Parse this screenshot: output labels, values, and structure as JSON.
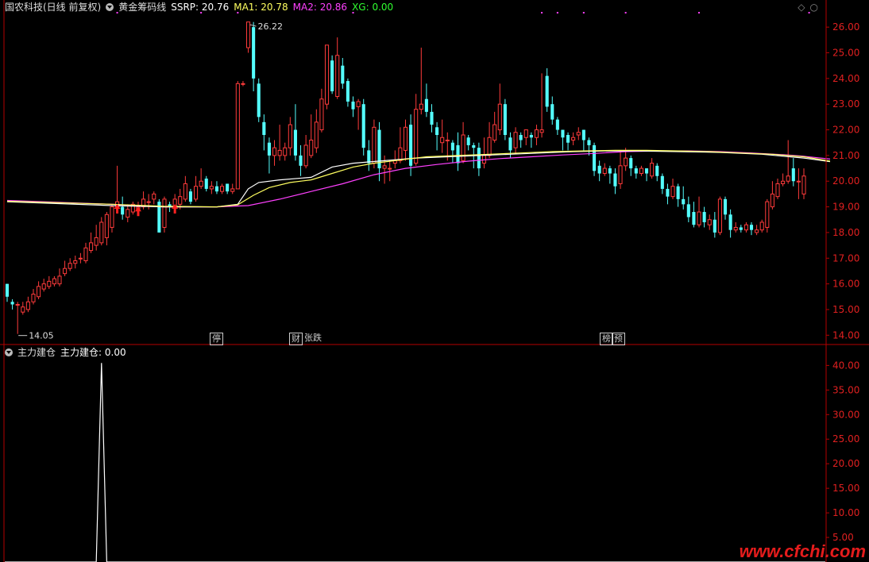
{
  "header": {
    "stock_title": "国农科技(日线 前复权)",
    "indicator_name": "黄金筹码线",
    "ssrp": "SSRP: 20.76",
    "ma1": "MA1: 20.78",
    "ma2": "MA2: 20.86",
    "xg": "XG: 0.00"
  },
  "sub_header": {
    "indicator_name": "主力建仓",
    "value_label": "主力建仓: 0.00"
  },
  "annotations": {
    "high": "26.22",
    "low": "14.05"
  },
  "tags": [
    {
      "text": "停",
      "color": "#2fb3b3"
    },
    {
      "text": "财",
      "color": "#7aa8ff"
    },
    {
      "text": "张",
      "color": "#e04040"
    },
    {
      "text": "跌",
      "color": "#30c030"
    },
    {
      "text": "榜",
      "color": "#e08020"
    },
    {
      "text": "预",
      "color": "#e0a020"
    }
  ],
  "watermark": "www.cfchi.com",
  "colors": {
    "up": "#ff3b3b",
    "down": "#54ffff",
    "ma1": "#ffff60",
    "ma2": "#ff40ff",
    "ssrp": "#ffffff",
    "axis": "#b40000"
  },
  "chart_data": [
    {
      "type": "candlestick",
      "title": "",
      "ylim": [
        13.7,
        26.5
      ],
      "yticks": [
        14.0,
        15.0,
        16.0,
        17.0,
        18.0,
        19.0,
        20.0,
        21.0,
        22.0,
        23.0,
        24.0,
        25.0,
        26.0
      ],
      "ytick_labels": [
        "14.00",
        "15.00",
        "16.00",
        "17.00",
        "18.00",
        "19.00",
        "20.00",
        "21.00",
        "22.00",
        "23.00",
        "24.00",
        "25.00",
        "26.00"
      ],
      "candles": [
        [
          16.0,
          15.5,
          16.0,
          15.3
        ],
        [
          15.3,
          15.2,
          15.4,
          15.0
        ],
        [
          15.2,
          15.2,
          15.3,
          14.05
        ],
        [
          14.9,
          15.1,
          15.3,
          14.8
        ],
        [
          15.0,
          15.3,
          15.5,
          14.9
        ],
        [
          15.3,
          15.6,
          15.8,
          15.2
        ],
        [
          15.5,
          15.9,
          16.1,
          15.4
        ],
        [
          15.8,
          16.0,
          16.2,
          15.7
        ],
        [
          15.9,
          16.1,
          16.3,
          15.8
        ],
        [
          16.0,
          16.2,
          16.3,
          15.9
        ],
        [
          16.0,
          16.3,
          16.6,
          15.9
        ],
        [
          16.4,
          16.6,
          16.9,
          16.3
        ],
        [
          16.6,
          16.8,
          17.0,
          16.5
        ],
        [
          16.8,
          16.9,
          17.1,
          16.6
        ],
        [
          17.0,
          17.0,
          17.2,
          16.8
        ],
        [
          16.9,
          17.4,
          17.6,
          16.8
        ],
        [
          17.3,
          17.6,
          18.0,
          17.2
        ],
        [
          17.5,
          17.8,
          18.3,
          17.3
        ],
        [
          17.6,
          18.4,
          18.6,
          17.5
        ],
        [
          17.8,
          18.7,
          18.8,
          17.5
        ],
        [
          18.2,
          19.0,
          19.1,
          18.0
        ],
        [
          19.0,
          19.2,
          20.6,
          18.8
        ],
        [
          19.0,
          18.7,
          19.4,
          18.5
        ],
        [
          18.6,
          18.9,
          19.1,
          18.4
        ],
        [
          18.8,
          19.1,
          19.2,
          18.7
        ],
        [
          18.9,
          19.0,
          19.2,
          18.7
        ],
        [
          19.0,
          19.3,
          19.6,
          18.9
        ],
        [
          19.2,
          19.2,
          19.5,
          18.9
        ],
        [
          19.3,
          19.5,
          19.6,
          19.1
        ],
        [
          19.2,
          18.0,
          19.3,
          18.0
        ],
        [
          18.2,
          19.3,
          19.4,
          18.0
        ],
        [
          19.1,
          19.0,
          19.2,
          18.8
        ],
        [
          19.0,
          19.3,
          19.5,
          18.8
        ],
        [
          19.1,
          19.4,
          19.7,
          18.9
        ],
        [
          19.3,
          19.9,
          20.2,
          19.2
        ],
        [
          19.6,
          19.2,
          19.7,
          19.1
        ],
        [
          19.3,
          19.8,
          20.2,
          19.2
        ],
        [
          19.8,
          20.0,
          20.5,
          19.7
        ],
        [
          20.1,
          19.7,
          20.2,
          19.6
        ],
        [
          19.7,
          19.8,
          20.0,
          19.5
        ],
        [
          19.8,
          19.6,
          20.0,
          19.5
        ],
        [
          19.6,
          19.8,
          19.9,
          19.5
        ],
        [
          19.9,
          19.6,
          19.9,
          19.5
        ],
        [
          19.6,
          19.7,
          19.9,
          19.5
        ],
        [
          19.7,
          23.8,
          23.9,
          19.7
        ],
        [
          23.8,
          23.8,
          23.9,
          23.7
        ],
        [
          25.2,
          26.2,
          26.2,
          25.0
        ],
        [
          26.0,
          24.0,
          26.2,
          23.5
        ],
        [
          23.8,
          22.5,
          24.0,
          22.3
        ],
        [
          22.3,
          21.8,
          22.6,
          21.2
        ],
        [
          21.5,
          21.0,
          21.7,
          20.3
        ],
        [
          21.0,
          21.3,
          21.6,
          20.6
        ],
        [
          21.0,
          21.2,
          22.2,
          20.8
        ],
        [
          21.0,
          21.3,
          21.5,
          20.8
        ],
        [
          21.3,
          22.2,
          22.5,
          21.0
        ],
        [
          22.0,
          21.0,
          23.0,
          20.8
        ],
        [
          21.0,
          20.6,
          21.4,
          20.2
        ],
        [
          20.6,
          21.4,
          21.8,
          20.5
        ],
        [
          21.0,
          21.6,
          22.6,
          20.9
        ],
        [
          21.3,
          22.3,
          22.8,
          21.1
        ],
        [
          22.0,
          23.2,
          23.6,
          21.9
        ],
        [
          23.0,
          25.3,
          25.3,
          22.8
        ],
        [
          24.7,
          23.5,
          24.9,
          23.4
        ],
        [
          23.3,
          24.9,
          25.6,
          23.2
        ],
        [
          24.5,
          23.8,
          24.8,
          23.6
        ],
        [
          23.9,
          23.1,
          24.0,
          22.9
        ],
        [
          23.1,
          22.8,
          23.3,
          22.5
        ],
        [
          22.9,
          23.1,
          23.2,
          22.0
        ],
        [
          23.0,
          21.3,
          23.2,
          21.0
        ],
        [
          21.2,
          20.7,
          21.6,
          20.4
        ],
        [
          20.7,
          22.1,
          22.4,
          20.5
        ],
        [
          22.0,
          20.5,
          22.3,
          20.0
        ],
        [
          20.5,
          20.6,
          21.0,
          19.9
        ],
        [
          20.5,
          20.5,
          20.8,
          20.0
        ],
        [
          20.7,
          20.8,
          21.2,
          20.5
        ],
        [
          20.8,
          21.3,
          22.1,
          20.7
        ],
        [
          21.2,
          22.1,
          22.4,
          20.8
        ],
        [
          22.2,
          20.6,
          22.6,
          20.2
        ],
        [
          20.7,
          22.8,
          23.4,
          20.6
        ],
        [
          22.8,
          23.0,
          25.2,
          22.6
        ],
        [
          23.2,
          22.7,
          23.8,
          22.5
        ],
        [
          22.7,
          22.2,
          23.0,
          21.9
        ],
        [
          22.1,
          21.8,
          22.3,
          21.2
        ],
        [
          21.5,
          21.7,
          22.4,
          21.1
        ],
        [
          21.6,
          21.6,
          21.9,
          20.8
        ],
        [
          21.5,
          21.2,
          21.6,
          20.7
        ],
        [
          21.4,
          20.7,
          21.9,
          20.4
        ],
        [
          20.8,
          21.8,
          22.3,
          20.7
        ],
        [
          21.7,
          21.4,
          21.8,
          21.2
        ],
        [
          21.4,
          21.3,
          21.5,
          20.5
        ],
        [
          21.3,
          20.5,
          21.5,
          20.2
        ],
        [
          20.7,
          21.0,
          21.7,
          20.5
        ],
        [
          21.0,
          21.7,
          22.3,
          20.9
        ],
        [
          21.6,
          22.2,
          22.7,
          21.5
        ],
        [
          22.0,
          23.0,
          23.8,
          21.8
        ],
        [
          23.0,
          21.8,
          23.2,
          21.6
        ],
        [
          21.7,
          21.2,
          21.9,
          20.9
        ],
        [
          21.3,
          21.9,
          22.1,
          21.1
        ],
        [
          21.8,
          21.6,
          21.9,
          21.3
        ],
        [
          21.7,
          22.0,
          22.0,
          21.4
        ],
        [
          21.8,
          21.7,
          21.9,
          21.3
        ],
        [
          21.7,
          22.0,
          22.2,
          21.4
        ],
        [
          21.9,
          22.0,
          24.2,
          21.7
        ],
        [
          24.1,
          22.9,
          24.4,
          22.7
        ],
        [
          23.0,
          22.4,
          23.3,
          22.2
        ],
        [
          22.4,
          22.0,
          22.5,
          21.8
        ],
        [
          22.0,
          21.7,
          22.0,
          21.2
        ],
        [
          21.8,
          21.5,
          21.9,
          21.2
        ],
        [
          21.6,
          21.7,
          21.9,
          21.4
        ],
        [
          21.8,
          21.9,
          22.1,
          21.6
        ],
        [
          22.0,
          21.6,
          22.0,
          21.2
        ],
        [
          21.6,
          21.4,
          21.7,
          21.0
        ],
        [
          21.4,
          20.4,
          21.5,
          20.2
        ],
        [
          20.6,
          20.3,
          20.8,
          20.0
        ],
        [
          20.3,
          20.5,
          20.7,
          20.2
        ],
        [
          20.5,
          20.3,
          20.6,
          19.9
        ],
        [
          20.3,
          19.8,
          20.5,
          19.5
        ],
        [
          19.9,
          20.6,
          21.2,
          19.7
        ],
        [
          20.6,
          20.9,
          21.3,
          20.4
        ],
        [
          20.9,
          20.5,
          21.0,
          20.2
        ],
        [
          20.5,
          20.3,
          20.6,
          20.1
        ],
        [
          20.3,
          20.5,
          20.6,
          20.2
        ],
        [
          20.5,
          20.3,
          20.5,
          20.0
        ],
        [
          20.2,
          20.7,
          20.9,
          20.1
        ],
        [
          20.6,
          20.2,
          20.7,
          20.0
        ],
        [
          20.2,
          19.7,
          20.3,
          19.5
        ],
        [
          19.7,
          19.4,
          19.9,
          19.1
        ],
        [
          19.4,
          19.8,
          20.1,
          19.3
        ],
        [
          19.8,
          19.3,
          19.9,
          19.0
        ],
        [
          19.3,
          19.1,
          19.8,
          18.9
        ],
        [
          19.1,
          18.6,
          19.4,
          18.4
        ],
        [
          18.8,
          18.3,
          19.2,
          18.2
        ],
        [
          18.3,
          18.8,
          19.4,
          18.2
        ],
        [
          18.8,
          18.4,
          19.0,
          18.2
        ],
        [
          18.3,
          18.5,
          18.7,
          18.1
        ],
        [
          18.5,
          18.0,
          18.8,
          17.8
        ],
        [
          18.0,
          19.3,
          19.4,
          17.9
        ],
        [
          19.3,
          18.7,
          19.4,
          18.5
        ],
        [
          18.7,
          18.1,
          18.9,
          17.8
        ],
        [
          18.1,
          18.2,
          18.4,
          18.0
        ],
        [
          18.2,
          18.1,
          18.3,
          18.0
        ],
        [
          18.1,
          18.3,
          18.4,
          18.0
        ],
        [
          18.3,
          18.1,
          18.4,
          17.9
        ],
        [
          18.0,
          18.1,
          18.3,
          17.9
        ],
        [
          18.1,
          18.4,
          18.5,
          18.0
        ],
        [
          18.2,
          19.2,
          19.3,
          18.0
        ],
        [
          19.0,
          19.5,
          20.0,
          18.9
        ],
        [
          19.4,
          19.9,
          20.1,
          19.3
        ],
        [
          19.9,
          20.0,
          20.3,
          19.8
        ],
        [
          20.0,
          20.2,
          21.6,
          19.9
        ],
        [
          20.5,
          20.0,
          20.9,
          19.8
        ],
        [
          20.0,
          20.0,
          20.5,
          19.3
        ],
        [
          19.5,
          20.2,
          20.5,
          19.3
        ]
      ],
      "ma1": [
        [
          0,
          19.22
        ],
        [
          20,
          19.1
        ],
        [
          30,
          19.02
        ],
        [
          40,
          19.0
        ],
        [
          44,
          19.08
        ],
        [
          47,
          19.45
        ],
        [
          50,
          19.75
        ],
        [
          54,
          19.95
        ],
        [
          58,
          20.05
        ],
        [
          62,
          20.3
        ],
        [
          66,
          20.55
        ],
        [
          70,
          20.7
        ],
        [
          76,
          20.85
        ],
        [
          80,
          20.95
        ],
        [
          86,
          21.0
        ],
        [
          92,
          21.05
        ],
        [
          98,
          21.1
        ],
        [
          104,
          21.15
        ],
        [
          110,
          21.18
        ],
        [
          116,
          21.2
        ],
        [
          122,
          21.2
        ],
        [
          128,
          21.18
        ],
        [
          134,
          21.15
        ],
        [
          140,
          21.1
        ],
        [
          146,
          21.05
        ],
        [
          152,
          20.95
        ],
        [
          157,
          20.78
        ]
      ],
      "ma2": [
        [
          0,
          19.25
        ],
        [
          20,
          19.1
        ],
        [
          30,
          19.0
        ],
        [
          40,
          19.0
        ],
        [
          46,
          19.05
        ],
        [
          52,
          19.3
        ],
        [
          58,
          19.6
        ],
        [
          64,
          19.9
        ],
        [
          70,
          20.25
        ],
        [
          76,
          20.5
        ],
        [
          82,
          20.65
        ],
        [
          88,
          20.78
        ],
        [
          94,
          20.88
        ],
        [
          100,
          20.95
        ],
        [
          106,
          21.02
        ],
        [
          112,
          21.08
        ],
        [
          118,
          21.15
        ],
        [
          124,
          21.18
        ],
        [
          130,
          21.18
        ],
        [
          136,
          21.15
        ],
        [
          142,
          21.1
        ],
        [
          148,
          21.03
        ],
        [
          152,
          20.97
        ],
        [
          157,
          20.86
        ]
      ],
      "ssrp": [
        [
          0,
          19.2
        ],
        [
          20,
          19.05
        ],
        [
          30,
          19.0
        ],
        [
          40,
          19.0
        ],
        [
          44,
          19.1
        ],
        [
          46,
          19.7
        ],
        [
          48,
          19.95
        ],
        [
          52,
          20.05
        ],
        [
          58,
          20.15
        ],
        [
          62,
          20.55
        ],
        [
          66,
          20.7
        ],
        [
          72,
          20.8
        ],
        [
          78,
          20.9
        ],
        [
          84,
          20.95
        ],
        [
          90,
          21.0
        ],
        [
          96,
          21.05
        ],
        [
          102,
          21.1
        ],
        [
          108,
          21.15
        ],
        [
          114,
          21.18
        ],
        [
          120,
          21.18
        ],
        [
          128,
          21.15
        ],
        [
          136,
          21.12
        ],
        [
          144,
          21.05
        ],
        [
          152,
          20.9
        ],
        [
          157,
          20.76
        ]
      ],
      "buy_arrows": [
        21,
        25,
        32
      ],
      "magenta_dots": [
        21,
        37,
        44,
        66,
        102,
        105,
        110,
        118,
        132,
        153
      ]
    },
    {
      "type": "line",
      "title": "",
      "ylim": [
        0,
        42
      ],
      "yticks": [
        5,
        10,
        15,
        20,
        25,
        30,
        35,
        40
      ],
      "ytick_labels": [
        "5.00",
        "10.00",
        "15.00",
        "20.00",
        "25.00",
        "30.00",
        "35.00",
        "40.00"
      ],
      "spike": {
        "start": 17,
        "peak": 18,
        "end": 19,
        "value": 40.5
      }
    }
  ]
}
